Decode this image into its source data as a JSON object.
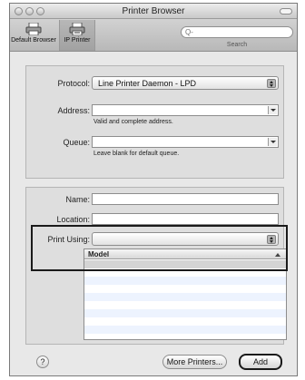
{
  "window": {
    "title": "Printer Browser"
  },
  "toolbar": {
    "items": [
      {
        "label": "Default Browser",
        "icon": "printer-icon"
      },
      {
        "label": "IP Printer",
        "icon": "ip-printer-icon"
      }
    ],
    "search": {
      "placeholder": "Q-",
      "label": "Search"
    }
  },
  "ip_section": {
    "protocol_label": "Protocol:",
    "protocol_value": "Line Printer Daemon - LPD",
    "address_label": "Address:",
    "address_value": "",
    "address_hint": "Valid and complete address.",
    "queue_label": "Queue:",
    "queue_value": "",
    "queue_hint": "Leave blank for default queue."
  },
  "printer_section": {
    "name_label": "Name:",
    "name_value": "",
    "location_label": "Location:",
    "location_value": "",
    "print_using_label": "Print Using:",
    "print_using_value": "",
    "model_header": "Model",
    "models": [
      ""
    ]
  },
  "footer": {
    "help_label": "?",
    "more_printers_label": "More Printers...",
    "add_label": "Add"
  }
}
